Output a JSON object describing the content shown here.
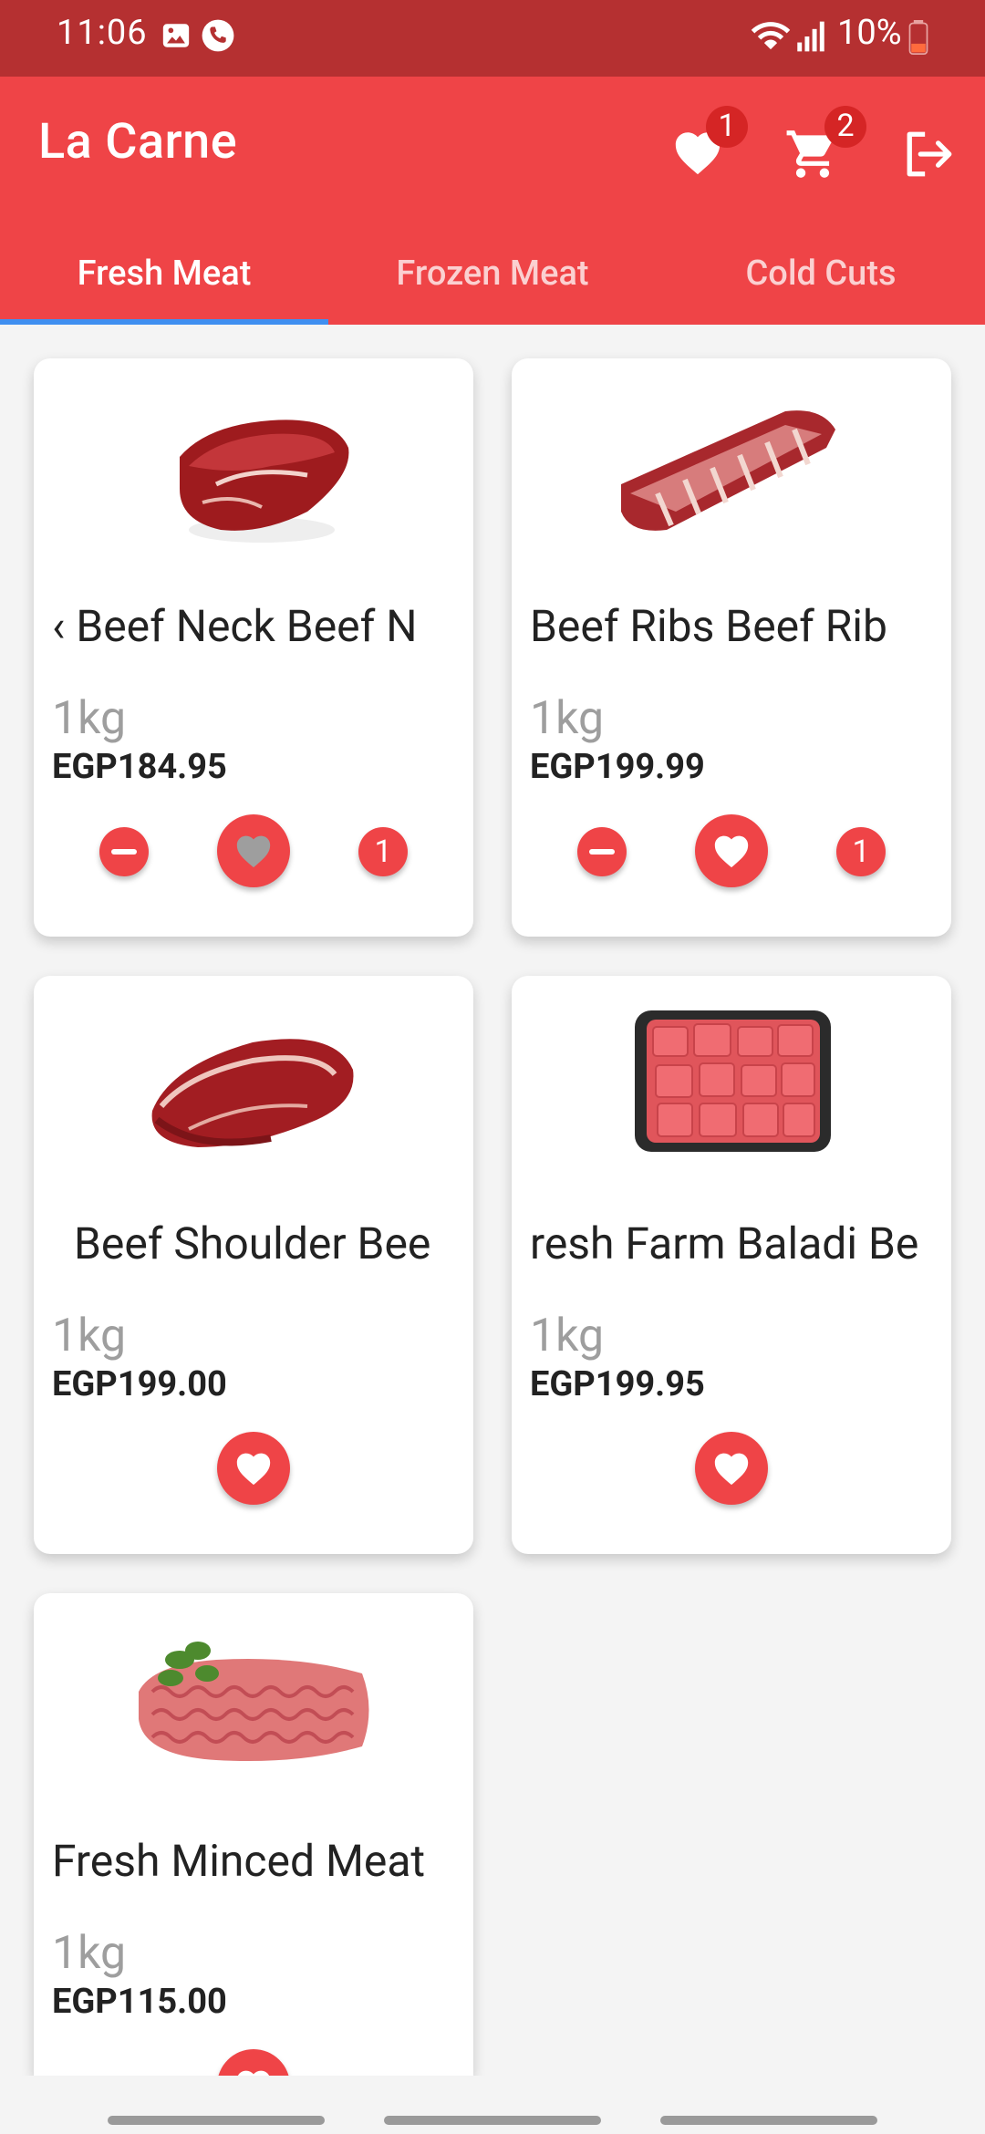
{
  "status_bar": {
    "time": "11:06",
    "battery": "10%"
  },
  "app_bar": {
    "title": "La Carne",
    "favorites_count": "1",
    "cart_count": "2"
  },
  "tabs": [
    {
      "label": "Fresh Meat",
      "active": true
    },
    {
      "label": "Frozen Meat",
      "active": false
    },
    {
      "label": "Cold Cuts",
      "active": false
    }
  ],
  "products": [
    {
      "name": "Beef Neck  Beef Neck",
      "name_visible": "‹  Beef Neck  Beef N",
      "weight": "1kg",
      "price": "EGP184.95",
      "quantity": "1",
      "favorited": false
    },
    {
      "name": "Beef Ribs  Beef Ribs",
      "name_visible": "Beef Ribs  Beef Rib",
      "weight": "1kg",
      "price": "EGP199.99",
      "quantity": "1",
      "favorited": true
    },
    {
      "name": "Beef Shoulder  Beef Shoulder",
      "name_visible": "Beef Shoulder  Bee",
      "weight": "1kg",
      "price": "EGP199.00",
      "favorited": true
    },
    {
      "name": "Fresh Farm Baladi Beef",
      "name_visible": "resh Farm Baladi Be",
      "weight": "1kg",
      "price": "EGP199.95",
      "favorited": true
    },
    {
      "name": "Fresh Minced Meat",
      "name_visible": "Fresh Minced Meat",
      "weight": "1kg",
      "price": "EGP115.00",
      "favorited": true
    }
  ],
  "colors": {
    "primary": "#ef4447",
    "status_bar": "#b53031",
    "tab_indicator": "#3f8ff0",
    "badge": "#d52525"
  }
}
